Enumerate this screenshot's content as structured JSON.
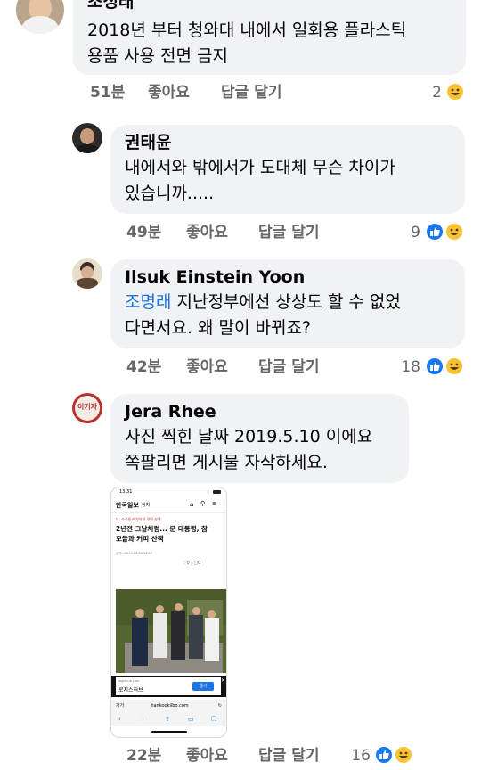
{
  "comments": [
    {
      "author": "조성래",
      "text_line1": "2018년 부터 청와대 내에서 일회용 플라스틱",
      "text_line2": "용품 사용 전면 금지",
      "time": "51분",
      "like_label": "좋아요",
      "reply_label": "답글 달기",
      "reaction_count": "2",
      "reactions": [
        "haha-icon"
      ]
    },
    {
      "author": "권태윤",
      "text_line1": "내에서와 밖에서가 도대체 무슨 차이가",
      "text_line2": "있습니까.....",
      "time": "49분",
      "like_label": "좋아요",
      "reply_label": "답글 달기",
      "reaction_count": "9",
      "reactions": [
        "like-icon",
        "haha-icon"
      ]
    },
    {
      "author": "Ilsuk Einstein Yoon",
      "mention": "조명래",
      "text_line1": " 지난정부에선 상상도 할 수 없었",
      "text_line2": "다면서요. 왜 말이 바뀌죠?",
      "time": "42분",
      "like_label": "좋아요",
      "reply_label": "답글 달기",
      "reaction_count": "18",
      "reactions": [
        "like-icon",
        "haha-icon"
      ]
    },
    {
      "author": "Jera Rhee",
      "avatar_text": "이기자",
      "text_line1": "사진 찍힌 날짜 2019.5.10 이에요",
      "text_line2": "쪽팔리면 게시물 자삭하세요.",
      "time": "22분",
      "like_label": "좋아요",
      "reply_label": "답글 달기",
      "reaction_count": "16",
      "reactions": [
        "like-icon",
        "haha-icon"
      ]
    }
  ],
  "attachment": {
    "status_time": "13:31",
    "brand": "한국일보",
    "section": "정치",
    "kicker": "또, 수석들과 청와대 경내 산책",
    "headline_line1": "2년전 그날처럼... 문 대통령, 참",
    "headline_line2": "모들과 커피 산책",
    "byline": "입력 : 2019.05.10 14:00",
    "ad_brand": "로지스허브",
    "ad_small": "logishub.com",
    "ad_button": "열기",
    "url_left": "가가",
    "url": "hankookilbo.com"
  },
  "colors": {
    "bubble": "#f0f2f5",
    "meta_text": "#65676b",
    "mention": "#1b74e4",
    "like_blue": "#1877f2",
    "haha_yellow": "#f7c234"
  }
}
